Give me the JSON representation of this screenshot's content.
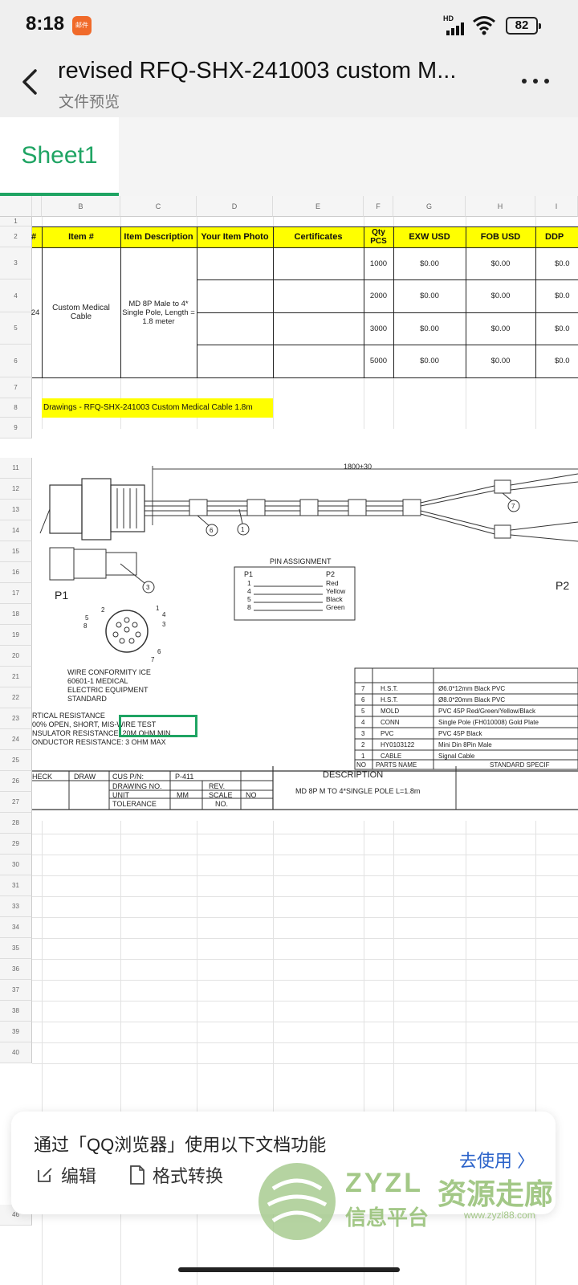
{
  "status": {
    "time": "8:18",
    "app_badge": "邮件",
    "network": "HD",
    "battery": "82"
  },
  "header": {
    "title": "revised RFQ-SHX-241003 custom M...",
    "subtitle": "文件预览"
  },
  "tabs": [
    {
      "label": "Sheet1",
      "active": true
    }
  ],
  "columns": [
    "B",
    "C",
    "D",
    "E",
    "F",
    "G",
    "H",
    "I"
  ],
  "rows": [
    "1",
    "2",
    "3",
    "4",
    "5",
    "6",
    "7",
    "8",
    "9",
    "11",
    "12",
    "13",
    "14",
    "15",
    "16",
    "17",
    "18",
    "19",
    "20",
    "21",
    "22",
    "23",
    "24",
    "25",
    "26",
    "27",
    "28",
    "29",
    "30",
    "31",
    "33",
    "34",
    "35",
    "36",
    "37",
    "38",
    "39",
    "40",
    "46"
  ],
  "table": {
    "header_cells": [
      "#",
      "Item #",
      "Item Description",
      "Your Item Photo",
      "Certificates",
      "Qty PCS",
      "EXW USD",
      "FOB USD",
      "DDP"
    ],
    "row_index": "24",
    "item": "Custom Medical Cable",
    "description": "MD 8P Male to 4* Single Pole, Length = 1.8 meter",
    "quantities": [
      "1000",
      "2000",
      "3000",
      "5000"
    ],
    "exw": [
      "$0.00",
      "$0.00",
      "$0.00",
      "$0.00"
    ],
    "fob": [
      "$0.00",
      "$0.00",
      "$0.00",
      "$0.00"
    ],
    "ddp": [
      "$0.0",
      "$0.0",
      "$0.0",
      "$0.0"
    ]
  },
  "drawing_link": "Drawings - RFQ-SHX-241003 Custom Medical Cable 1.8m",
  "drawing": {
    "length_dim": "1800±30",
    "callouts": [
      "6",
      "1",
      "7",
      "3"
    ],
    "p1_label": "P1",
    "p2_label": "P2",
    "pin_title": "PIN ASSIGNMENT",
    "pin_cols": [
      "P1",
      "P2"
    ],
    "pins": [
      {
        "p1": "1",
        "p2": "Red"
      },
      {
        "p1": "4",
        "p2": "Yellow"
      },
      {
        "p1": "5",
        "p2": "Black"
      },
      {
        "p1": "8",
        "p2": "Green"
      }
    ],
    "pin_numbers": [
      "1",
      "2",
      "3",
      "4",
      "5",
      "6",
      "7",
      "8"
    ],
    "conformity": [
      "WIRE CONFORMITY ICE",
      "60601-1 MEDICAL",
      "ELECTRIC EQUIPMENT",
      "STANDARD"
    ],
    "tests": [
      "RTICAL RESISTANCE",
      "00% OPEN, SHORT, MIS-WIRE TEST",
      "NSULATOR RESISTANCE: 20M OHM MIN",
      "ONDUCTOR RESISTANCE: 3 OHM MAX"
    ],
    "parts": [
      {
        "no": "7",
        "name": "H.S.T.",
        "spec": "Ø6.0*12mm Black PVC"
      },
      {
        "no": "6",
        "name": "H.S.T.",
        "spec": "Ø8.0*20mm Black PVC"
      },
      {
        "no": "5",
        "name": "MOLD",
        "spec": "PVC 45P Red/Green/Yellow/Black"
      },
      {
        "no": "4",
        "name": "CONN",
        "spec": "Single Pole (FH010008) Gold Plate"
      },
      {
        "no": "3",
        "name": "PVC",
        "spec": "PVC 45P Black"
      },
      {
        "no": "2",
        "name": "HY0103122",
        "spec": "Mini Din 8Pin Male"
      },
      {
        "no": "1",
        "name": "CABLE",
        "spec": "Signal Cable"
      }
    ],
    "parts_header": {
      "no": "NO",
      "name": "PARTS NAME",
      "spec": "STANDARD SPECIF"
    },
    "title_block": {
      "check": "HECK",
      "draw": "DRAW",
      "cus_pn": "CUS P/N:",
      "pn_value": "P-411",
      "drawing_no": "DRAWING NO.",
      "rev": "REV.",
      "unit": "UNIT",
      "mm": "MM",
      "scale": "SCALE",
      "no_label": "NO",
      "tolerance": "TOLERANCE",
      "no2": "NO.",
      "description_title": "DESCRIPTION",
      "description": "MD 8P M TO 4*SINGLE POLE L=1.8m"
    }
  },
  "banner": {
    "title": "通过「QQ浏览器」使用以下文档功能",
    "edit": "编辑",
    "convert": "格式转换",
    "go": "去使用 〉"
  },
  "watermark": {
    "brand": "ZYZL",
    "sub": "信息平台",
    "cn": "资源走廊",
    "url": "www.zyzl88.com"
  }
}
